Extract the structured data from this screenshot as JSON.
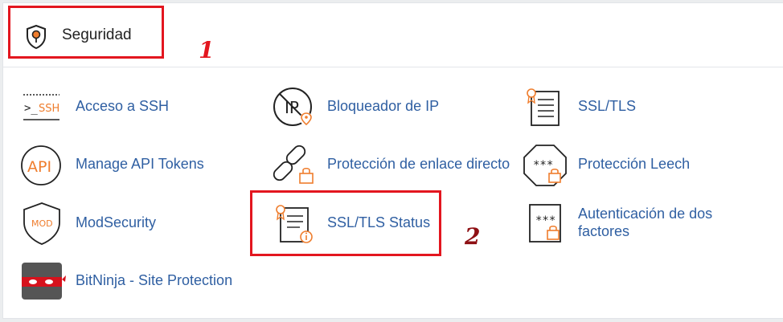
{
  "section": {
    "title": "Seguridad",
    "icon": "shield-icon"
  },
  "items": [
    {
      "id": "ssh",
      "label": "Acceso a SSH",
      "icon": "ssh-terminal-icon"
    },
    {
      "id": "ip-blocker",
      "label": "Bloqueador de IP",
      "icon": "ip-blocker-icon"
    },
    {
      "id": "ssl-tls",
      "label": "SSL/TLS",
      "icon": "certificate-icon"
    },
    {
      "id": "api-tokens",
      "label": "Manage API Tokens",
      "icon": "api-icon"
    },
    {
      "id": "hotlink",
      "label": "Protección de enlace directo",
      "icon": "broken-link-lock-icon"
    },
    {
      "id": "leech",
      "label": "Protección Leech",
      "icon": "leech-octagon-icon"
    },
    {
      "id": "modsecurity",
      "label": "ModSecurity",
      "icon": "mod-shield-icon"
    },
    {
      "id": "ssl-status",
      "label": "SSL/TLS Status",
      "icon": "certificate-info-icon"
    },
    {
      "id": "2fa",
      "label": "Autenticación de dos factores",
      "icon": "two-factor-icon"
    },
    {
      "id": "bitninja",
      "label": "BitNinja - Site Protection",
      "icon": "bitninja-icon"
    }
  ],
  "annotations": {
    "step1": "1",
    "step2": "2"
  },
  "colors": {
    "link": "#2f5fa2",
    "accent": "#ef7d2d",
    "highlight": "#e3161f"
  }
}
